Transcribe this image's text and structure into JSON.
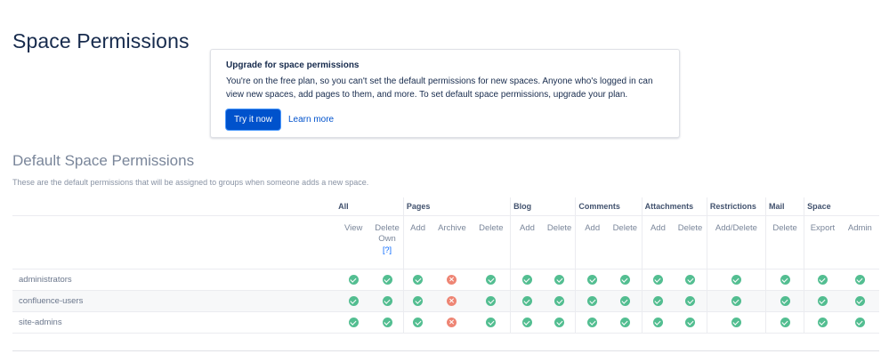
{
  "page": {
    "title": "Space Permissions"
  },
  "upgrade": {
    "title": "Upgrade for space permissions",
    "text": "You're on the free plan, so you can't set the default permissions for new spaces. Anyone who's logged in can view new spaces, add pages to them, and more. To set default space permissions, upgrade your plan.",
    "primary_label": "Try it now",
    "link_label": "Learn more"
  },
  "section": {
    "title": "Default Space Permissions",
    "description": "These are the default permissions that will be assigned to groups when someone adds a new space."
  },
  "table": {
    "groups": [
      "All",
      "Pages",
      "Blog",
      "Comments",
      "Attachments",
      "Restrictions",
      "Mail",
      "Space"
    ],
    "columns": [
      "View",
      "Delete Own",
      "Add",
      "Archive",
      "Delete",
      "Add",
      "Delete",
      "Add",
      "Delete",
      "Add",
      "Delete",
      "Add/Delete",
      "Delete",
      "Export",
      "Admin"
    ],
    "help_label": "[?]",
    "icons": {
      "allowed": "check-circle-icon",
      "denied": "cross-circle-icon"
    },
    "colors": {
      "allowed": "#36b37e",
      "denied": "#ee8574"
    },
    "rows": [
      {
        "name": "administrators",
        "perms": [
          true,
          true,
          true,
          false,
          true,
          true,
          true,
          true,
          true,
          true,
          true,
          true,
          true,
          true,
          true
        ]
      },
      {
        "name": "confluence-users",
        "perms": [
          true,
          true,
          true,
          false,
          true,
          true,
          true,
          true,
          true,
          true,
          true,
          true,
          true,
          true,
          true
        ]
      },
      {
        "name": "site-admins",
        "perms": [
          true,
          true,
          true,
          false,
          true,
          true,
          true,
          true,
          true,
          true,
          true,
          true,
          true,
          true,
          true
        ]
      }
    ]
  }
}
